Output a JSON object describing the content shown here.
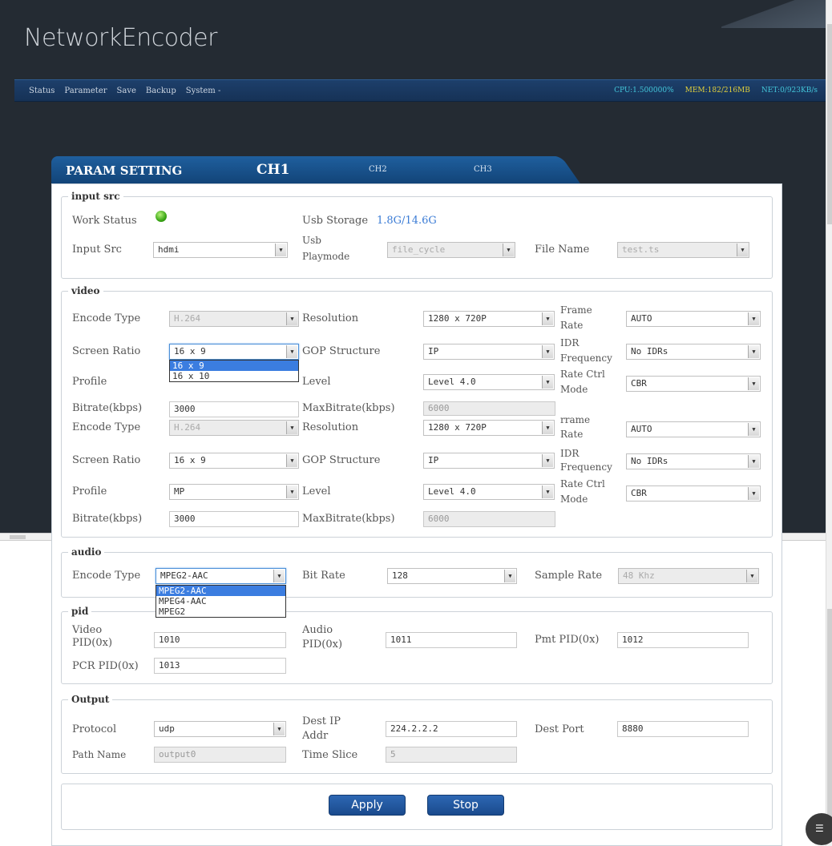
{
  "app": {
    "logo": "NetworkEncoder",
    "menu": [
      "Status",
      "Parameter",
      "Save",
      "Backup",
      "System -"
    ],
    "stats": {
      "cpu": "CPU:1.500000%",
      "mem": "MEM:182/216MB",
      "net": "NET:0/923KB/s"
    }
  },
  "tabs": {
    "title": "PARAM SETTING",
    "ch1": "CH1",
    "ch2": "CH2",
    "ch3": "CH3"
  },
  "input_src": {
    "legend": "input src",
    "work_status_label": "Work Status",
    "usb_storage_label": "Usb Storage",
    "usb_storage_value": "1.8G/14.6G",
    "input_src_label": "Input Src",
    "input_src_value": "hdmi",
    "usb_playmode_label1": "Usb",
    "usb_playmode_label2": "Playmode",
    "usb_playmode_value": "file_cycle",
    "file_name_label": "File Name",
    "file_name_value": "test.ts"
  },
  "video": {
    "legend": "video",
    "encode_type_label": "Encode Type",
    "encode_type_value": "H.264",
    "resolution_label": "Resolution",
    "resolution_value": "1280 x 720P",
    "frame_rate_label1": "Frame",
    "frame_rate_label1b": "rrame",
    "frame_rate_label2": "Rate",
    "frame_rate_value": "AUTO",
    "screen_ratio_label": "Screen Ratio",
    "screen_ratio_value": "16 x 9",
    "screen_ratio_options": [
      "16 x 9",
      "16 x 10"
    ],
    "gop_label": "GOP Structure",
    "gop_value": "IP",
    "idr_label1": "IDR",
    "idr_label2": "Frequency",
    "idr_value": "No IDRs",
    "profile_label": "Profile",
    "profile_value": "MP",
    "level_label": "Level",
    "level_value": "Level 4.0",
    "rate_ctrl_label1": "Rate Ctrl",
    "rate_ctrl_label2": "Mode",
    "rate_ctrl_value": "CBR",
    "bitrate_label": "Bitrate(kbps)",
    "bitrate_value": "3000",
    "maxbitrate_label": "MaxBitrate(kbps)",
    "maxbitrate_value": "6000"
  },
  "audio": {
    "legend": "audio",
    "encode_type_label": "Encode Type",
    "encode_type_value": "MPEG2-AAC",
    "encode_type_options": [
      "MPEG2-AAC",
      "MPEG4-AAC",
      "MPEG2"
    ],
    "bit_rate_label": "Bit Rate",
    "bit_rate_value": "128",
    "sample_rate_label": "Sample Rate",
    "sample_rate_value": "48 Khz"
  },
  "pid": {
    "legend": "pid",
    "video_label1": "Video",
    "video_label2": "PID(0x)",
    "video_value": "1010",
    "audio_label1": "Audio",
    "audio_label2": "PID(0x)",
    "audio_value": "1011",
    "pmt_label": "Pmt PID(0x)",
    "pmt_value": "1012",
    "pcr_label": "PCR PID(0x)",
    "pcr_value": "1013"
  },
  "output": {
    "legend": "Output",
    "protocol_label": "Protocol",
    "protocol_value": "udp",
    "dest_ip_label1": "Dest IP",
    "dest_ip_label2": "Addr",
    "dest_ip_value": "224.2.2.2",
    "dest_port_label": "Dest Port",
    "dest_port_value": "8880",
    "path_name_label": "Path Name",
    "path_name_value": "output0",
    "time_slice_label": "Time Slice",
    "time_slice_value": "5"
  },
  "actions": {
    "apply": "Apply",
    "stop": "Stop"
  }
}
